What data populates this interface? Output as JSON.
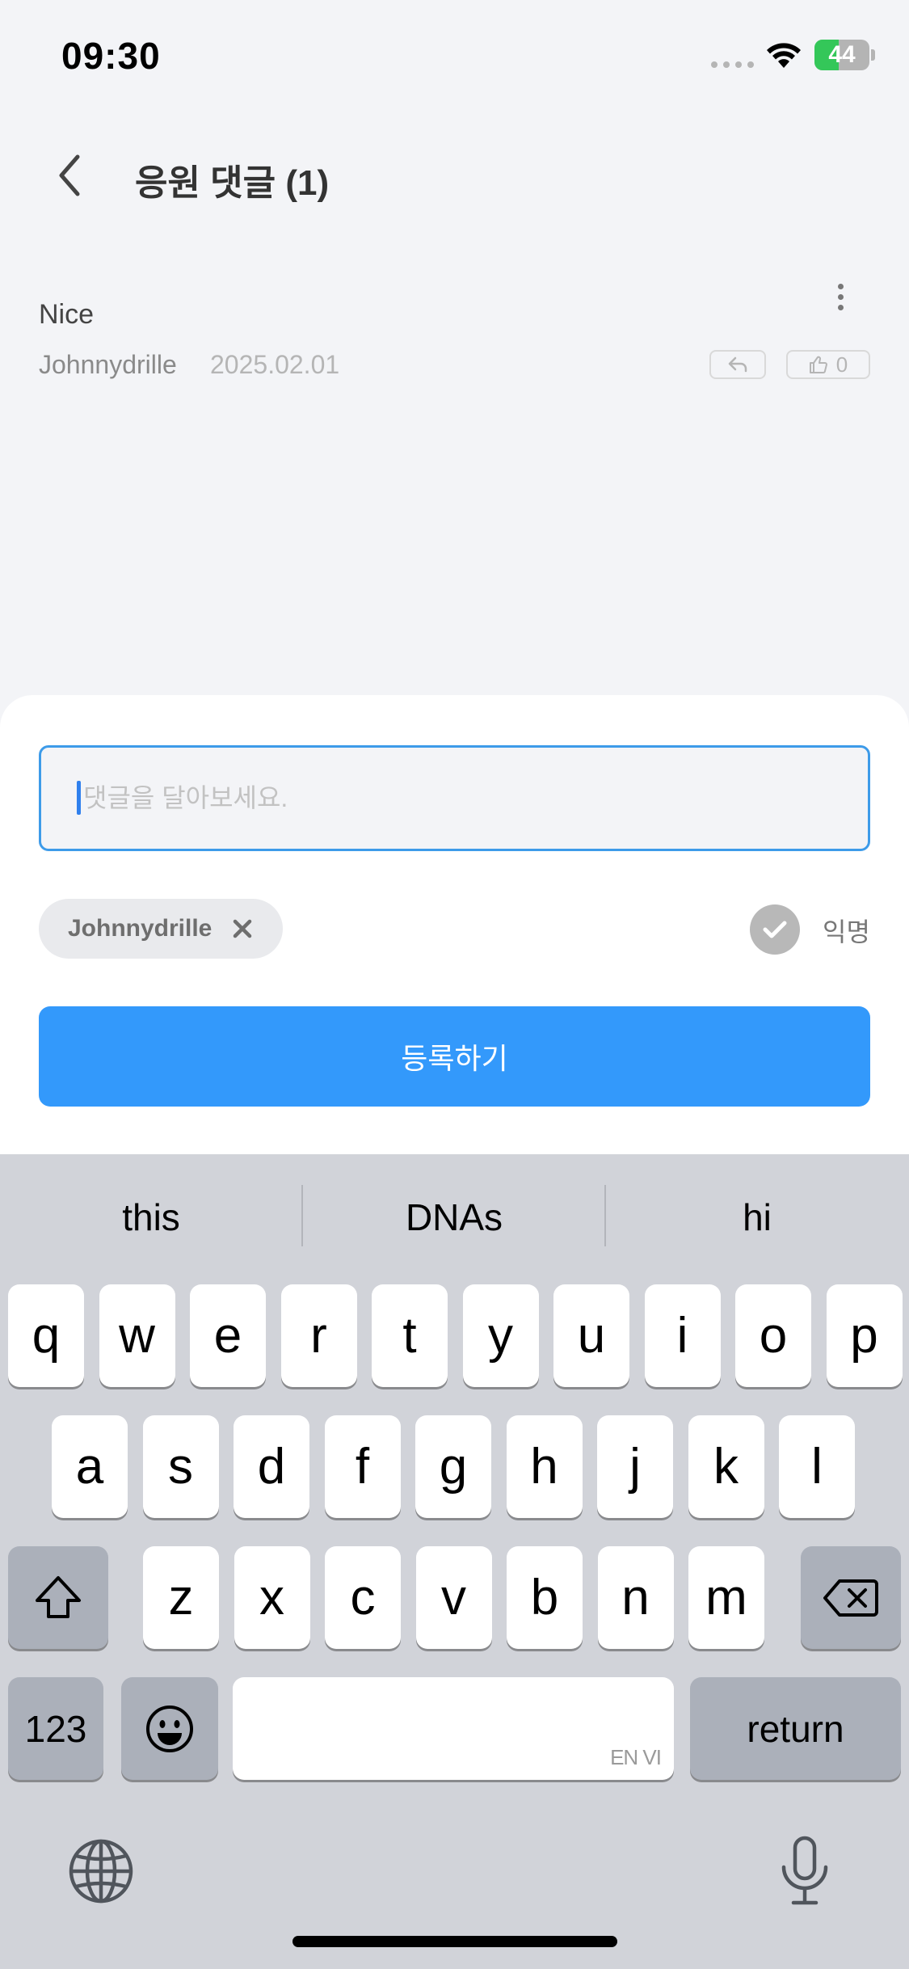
{
  "status_bar": {
    "time": "09:30",
    "battery": "44",
    "battery_level": 0.44
  },
  "header": {
    "title": "응원 댓글 (1)"
  },
  "comments": [
    {
      "text": "Nice",
      "author": "Johnnydrille",
      "date": "2025.02.01",
      "likes": "0"
    }
  ],
  "composer": {
    "placeholder": "댓글을 달아보세요.",
    "name_chip": "Johnnydrille",
    "anonymous_label": "익명",
    "anonymous_checked": true,
    "submit_label": "등록하기"
  },
  "keyboard": {
    "suggestions": [
      "this",
      "DNAs",
      "hi"
    ],
    "row1": [
      "q",
      "w",
      "e",
      "r",
      "t",
      "y",
      "u",
      "i",
      "o",
      "p"
    ],
    "row2": [
      "a",
      "s",
      "d",
      "f",
      "g",
      "h",
      "j",
      "k",
      "l"
    ],
    "row3": [
      "z",
      "x",
      "c",
      "v",
      "b",
      "n",
      "m"
    ],
    "numbers_label": "123",
    "return_label": "return",
    "space_hint": "EN VI"
  },
  "colors": {
    "accent": "#3399fb",
    "input_border": "#3d9be9",
    "battery": "#34c759"
  }
}
